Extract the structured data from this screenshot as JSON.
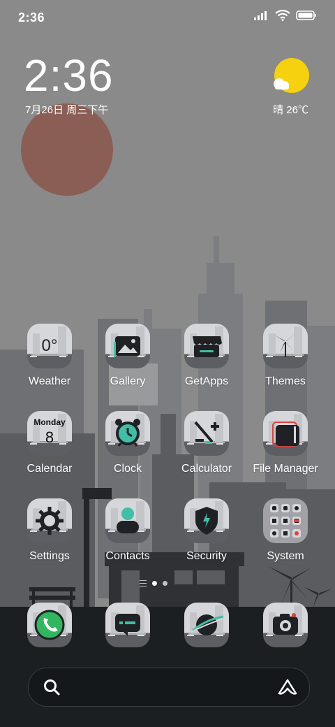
{
  "status_bar": {
    "time": "2:36",
    "icons": [
      "signal-icon",
      "wifi-icon",
      "battery-icon"
    ]
  },
  "clock_widget": {
    "time": "2:36",
    "date": "7月26日 周三下午"
  },
  "weather_widget": {
    "text": "晴 26℃",
    "icon": "sun-cloud-icon"
  },
  "apps": [
    {
      "label": "Weather",
      "icon": "weather-icon",
      "glyph_text": "0°"
    },
    {
      "label": "Gallery",
      "icon": "gallery-icon"
    },
    {
      "label": "GetApps",
      "icon": "store-icon"
    },
    {
      "label": "Themes",
      "icon": "pinwheel-icon"
    },
    {
      "label": "Calendar",
      "icon": "calendar-icon",
      "glyph_day": "Monday",
      "glyph_num": "8"
    },
    {
      "label": "Clock",
      "icon": "alarm-clock-icon"
    },
    {
      "label": "Calculator",
      "icon": "calculator-icon"
    },
    {
      "label": "File Manager",
      "icon": "folder-icon"
    },
    {
      "label": "Settings",
      "icon": "gear-icon"
    },
    {
      "label": "Contacts",
      "icon": "person-icon"
    },
    {
      "label": "Security",
      "icon": "shield-icon"
    },
    {
      "label": "System",
      "icon": "folder-grid-icon"
    }
  ],
  "dock": [
    "phone-icon",
    "messaging-icon",
    "browser-icon",
    "camera-icon"
  ],
  "page_indicator": {
    "pages": 2,
    "current": 1
  },
  "search": {
    "icon": "search-icon",
    "assistant_icon": "assistant-icon"
  },
  "colors": {
    "accent": "#3fbfa5",
    "sky": "#8a8a8a",
    "ground": "#1c1f22",
    "sun": "#8a5e55",
    "weather_sun": "#f6d10e"
  }
}
